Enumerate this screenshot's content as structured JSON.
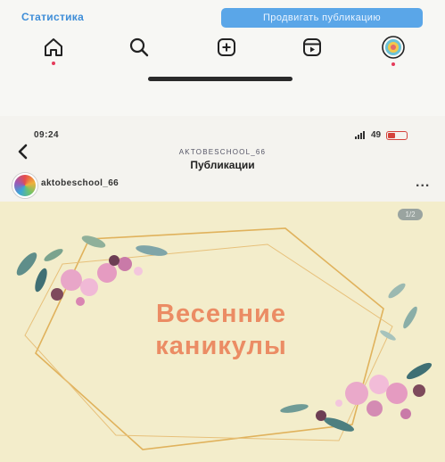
{
  "topbar": {
    "stats_label": "Статистика",
    "promote_label": "Продвигать публикацию"
  },
  "nav": {
    "items": [
      {
        "icon": "home-icon"
      },
      {
        "icon": "search-icon"
      },
      {
        "icon": "add-post-icon"
      },
      {
        "icon": "reels-icon"
      },
      {
        "icon": "profile-avatar-icon"
      }
    ]
  },
  "status_bar": {
    "time": "09:24",
    "battery": "49"
  },
  "header": {
    "username": "AKTOBESCHOOL_66",
    "title": "Публикации"
  },
  "post": {
    "username": "aktobeschool_66",
    "more": "...",
    "counter": "1/2",
    "text_line1": "Весенние",
    "text_line2": "каникулы"
  },
  "colors": {
    "accent_link": "#3f8ed8",
    "promote_button": "#5aa6e8",
    "post_background": "#f3edcb",
    "post_text": "#eb8c64",
    "frame": "#e0b25c"
  }
}
